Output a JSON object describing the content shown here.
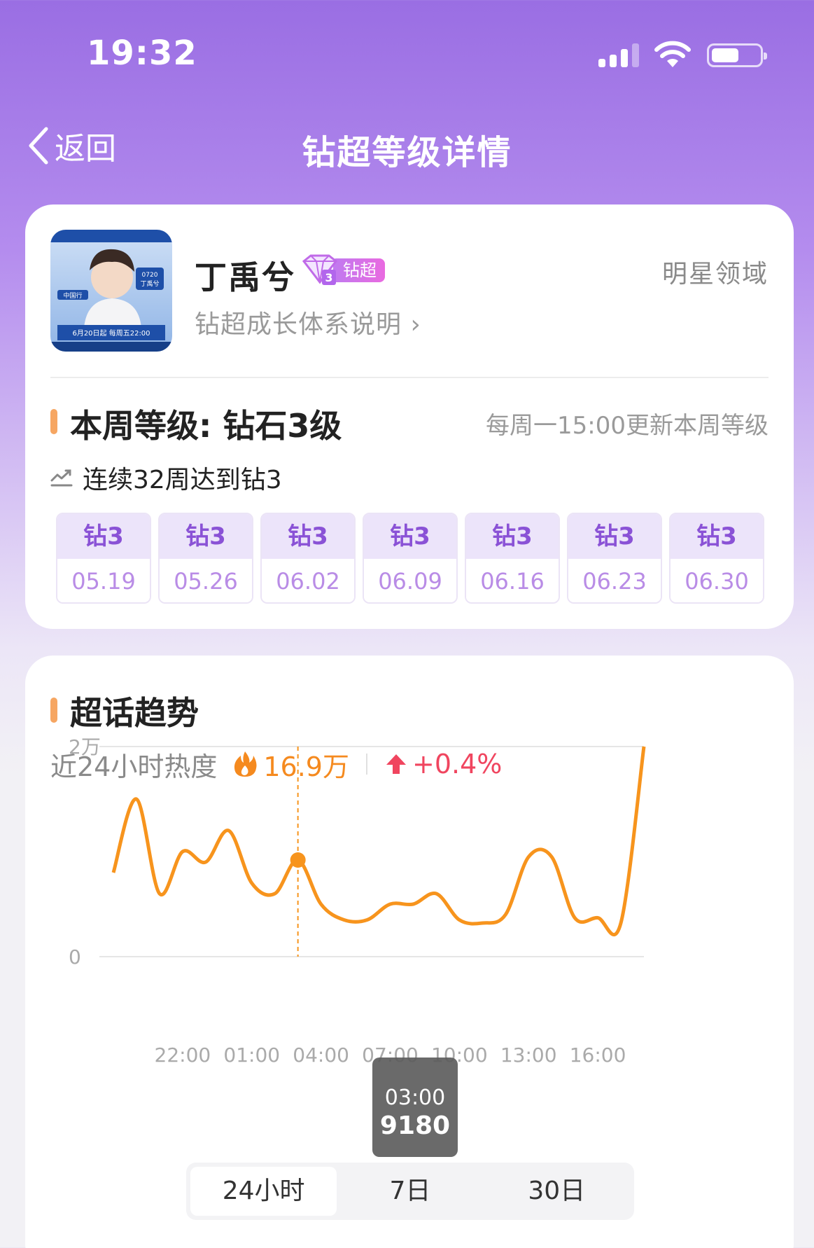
{
  "status_bar": {
    "time": "19:32"
  },
  "nav": {
    "back_label": "返回",
    "title": "钻超等级详情"
  },
  "profile": {
    "name": "丁禹兮",
    "badge_text": "钻超",
    "badge_level": "3",
    "domain": "明星领域",
    "growth_link": "钻超成长体系说明 ›",
    "avatar_texts": {
      "tag_date": "0720",
      "tag_name": "丁禹兮",
      "show": "中国行",
      "caption": "6月20日起 每周五22:00"
    }
  },
  "level": {
    "title": "本周等级: 钻石3级",
    "update_note": "每周一15:00更新本周等级",
    "streak": "连续32周达到钻3",
    "weeks": [
      {
        "level": "钻3",
        "date": "05.19"
      },
      {
        "level": "钻3",
        "date": "05.26"
      },
      {
        "level": "钻3",
        "date": "06.02"
      },
      {
        "level": "钻3",
        "date": "06.09"
      },
      {
        "level": "钻3",
        "date": "06.16"
      },
      {
        "level": "钻3",
        "date": "06.23"
      },
      {
        "level": "钻3",
        "date": "06.30"
      }
    ]
  },
  "trend": {
    "title": "超话趋势",
    "heat_label": "近24小时热度",
    "heat_value": "16.9万",
    "heat_change": "+0.4%",
    "tooltip": {
      "time": "03:00",
      "value": "9180"
    },
    "tabs": [
      "24小时",
      "7日",
      "30日"
    ],
    "active_tab": 0
  },
  "colors": {
    "accent_purple": "#8a52d6",
    "line_orange": "#f7941d",
    "heat_orange": "#f58a1f",
    "change_red": "#f0455f"
  },
  "chart_data": {
    "type": "line",
    "ylim": [
      0,
      20000
    ],
    "ytick_labels": [
      "2万",
      "0"
    ],
    "xtick_labels": [
      "22:00",
      "01:00",
      "04:00",
      "07:00",
      "10:00",
      "13:00",
      "16:00"
    ],
    "x_hours": [
      0,
      1,
      2,
      3,
      4,
      5,
      6,
      7,
      8,
      9,
      10,
      11,
      12,
      13,
      14,
      15,
      16,
      17,
      18,
      19,
      20,
      21,
      22,
      23
    ],
    "x_start": "19:00",
    "values": [
      8000,
      15000,
      6000,
      10000,
      9000,
      12000,
      7000,
      6000,
      9200,
      5000,
      3500,
      3500,
      5000,
      5000,
      6000,
      3500,
      3200,
      4000,
      9500,
      9500,
      3700,
      3700,
      3200,
      20000
    ],
    "highlight": {
      "time": "03:00",
      "value": 9180
    }
  }
}
